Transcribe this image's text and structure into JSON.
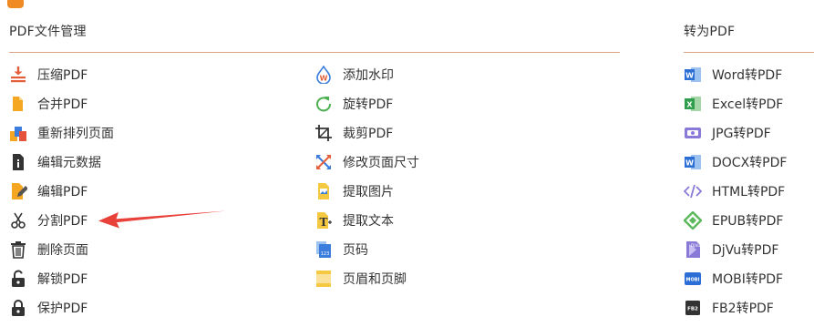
{
  "sections": {
    "pdf_manage_title": "PDF文件管理",
    "to_pdf_title": "转为PDF"
  },
  "col1": [
    "压缩PDF",
    "合并PDF",
    "重新排列页面",
    "编辑元数据",
    "编辑PDF",
    "分割PDF",
    "删除页面",
    "解锁PDF",
    "保护PDF"
  ],
  "col2": [
    "添加水印",
    "旋转PDF",
    "裁剪PDF",
    "修改页面尺寸",
    "提取图片",
    "提取文本",
    "页码",
    "页眉和页脚"
  ],
  "col3": [
    "Word转PDF",
    "Excel转PDF",
    "JPG转PDF",
    "DOCX转PDF",
    "HTML转PDF",
    "EPUB转PDF",
    "DjVu转PDF",
    "MOBI转PDF",
    "FB2转PDF"
  ],
  "icon_labels": {
    "word": "W",
    "excel": "X",
    "docx": "W",
    "mobi": "MOBI",
    "fb2": "FB2",
    "djvu": "DjVu",
    "page_number": "123"
  },
  "colors": {
    "accent_orange": "#f08a24",
    "arrow_red": "#e8413a",
    "rule": "#d9a38c"
  }
}
